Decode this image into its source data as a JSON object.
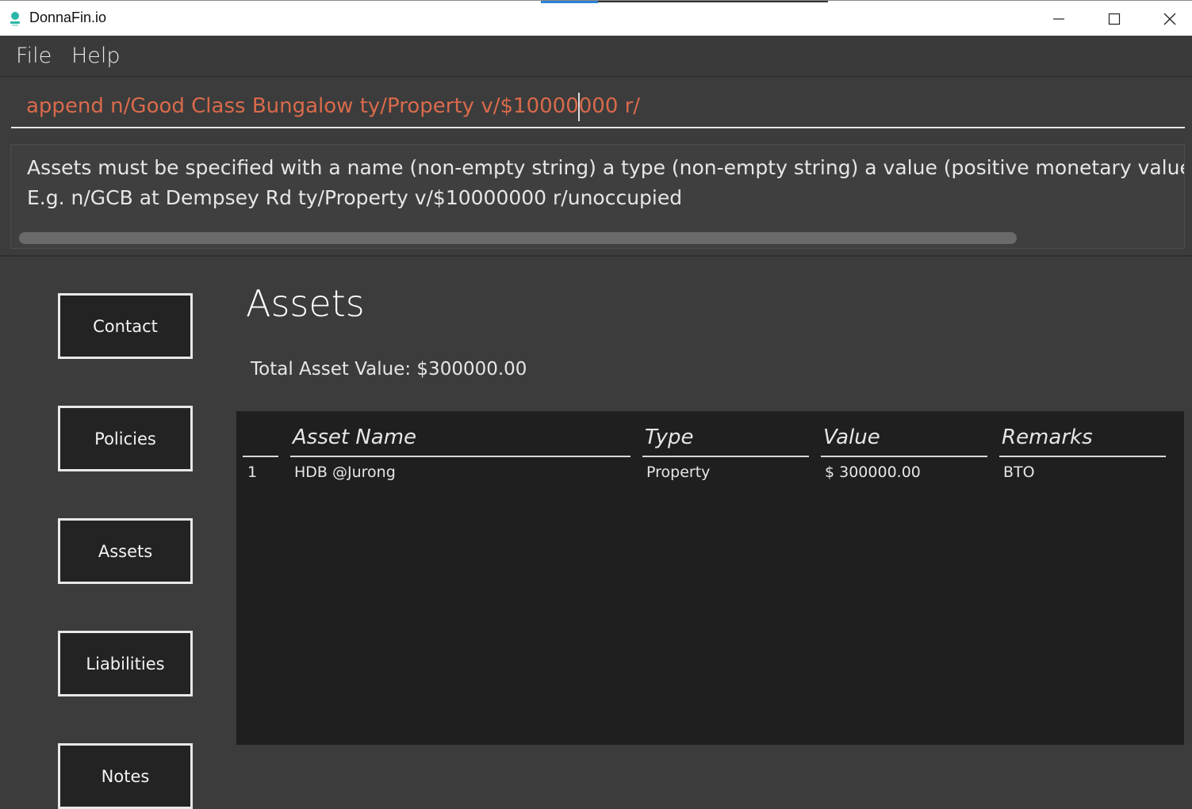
{
  "window": {
    "title": "DonnaFin.io"
  },
  "menu": {
    "items": [
      "File",
      "Help"
    ]
  },
  "command": {
    "value": "append n/Good Class Bungalow ty/Property v/$10000000 r/"
  },
  "result": {
    "line1": "Assets must be specified with a name (non-empty string) a type (non-empty string) a value (positive monetary value) a remark",
    "line2": "E.g. n/GCB at Dempsey Rd ty/Property v/$10000000 r/unoccupied"
  },
  "sidebar": {
    "items": [
      "Contact",
      "Policies",
      "Assets",
      "Liabilities",
      "Notes"
    ]
  },
  "panel": {
    "title": "Assets",
    "total": "Total Asset Value: $300000.00"
  },
  "table": {
    "headers": [
      "",
      "Asset Name",
      "Type",
      "Value",
      "Remarks"
    ],
    "rows": [
      {
        "index": "1",
        "name": "HDB @Jurong",
        "type": "Property",
        "value": "$ 300000.00",
        "remarks": "BTO"
      }
    ]
  },
  "colors": {
    "command_text": "#d96a4b",
    "background": "#3c3c3c",
    "table_background": "#1f1f1f",
    "accent": "#2b7fd6"
  }
}
